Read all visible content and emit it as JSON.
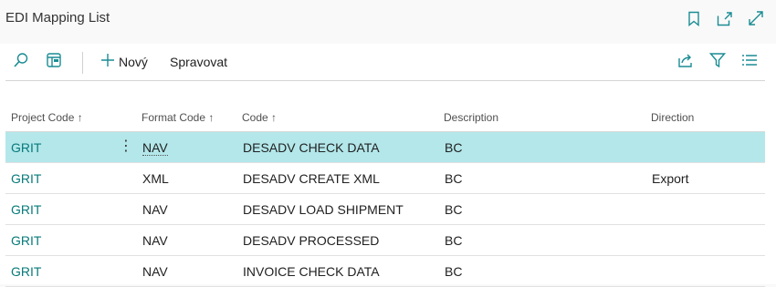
{
  "window": {
    "title": "EDI Mapping List",
    "icons": [
      "bookmark-icon",
      "open-in-new-window-icon",
      "expand-icon"
    ]
  },
  "toolbar": {
    "search_icon": "search-icon",
    "layout_icon": "layout-icon",
    "new_label": "Nový",
    "manage_label": "Spravovat",
    "right_icons": [
      "share-icon",
      "filter-icon",
      "list-view-icon"
    ]
  },
  "table": {
    "headers": {
      "project_code": "Project Code ↑",
      "format_code": "Format Code ↑",
      "code": "Code ↑",
      "description": "Description",
      "direction": "Direction"
    },
    "rows": [
      {
        "project_code": "GRIT",
        "format_code": "NAV",
        "code": "DESADV CHECK DATA",
        "description": "BC",
        "direction": ""
      },
      {
        "project_code": "GRIT",
        "format_code": "XML",
        "code": "DESADV CREATE XML",
        "description": "BC",
        "direction": "Export"
      },
      {
        "project_code": "GRIT",
        "format_code": "NAV",
        "code": "DESADV LOAD SHIPMENT",
        "description": "BC",
        "direction": ""
      },
      {
        "project_code": "GRIT",
        "format_code": "NAV",
        "code": "DESADV PROCESSED",
        "description": "BC",
        "direction": ""
      },
      {
        "project_code": "GRIT",
        "format_code": "NAV",
        "code": "INVOICE CHECK DATA",
        "description": "BC",
        "direction": ""
      }
    ],
    "selected_row": 0,
    "row_menu_glyph": "⋮"
  },
  "colors": {
    "selected_row": "#b3e7ea",
    "link": "#087a7a",
    "accent": "#1a8c93"
  }
}
